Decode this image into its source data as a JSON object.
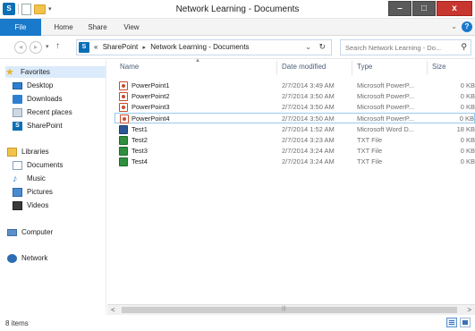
{
  "window": {
    "title": "Network Learning - Documents",
    "minimize_glyph": "–",
    "maximize_glyph": "□",
    "close_glyph": "x",
    "qat_sp_glyph": "S",
    "qat_dropdown_glyph": "▾"
  },
  "ribbon": {
    "tabs": [
      {
        "label": "File"
      },
      {
        "label": "Home"
      },
      {
        "label": "Share"
      },
      {
        "label": "View"
      }
    ],
    "expand_glyph": "⌄",
    "help_glyph": "?",
    "accent_color": "#1979ca"
  },
  "navigation": {
    "back_glyph": "◂",
    "forward_glyph": "▸",
    "history_glyph": "▾",
    "up_glyph": "↑"
  },
  "address": {
    "sp_glyph": "S",
    "overflow": "«",
    "crumbs": [
      "SharePoint",
      "Network Learning - Documents"
    ],
    "separator": "▸",
    "dropdown_glyph": "⌄",
    "refresh_glyph": "↻"
  },
  "search": {
    "placeholder": "Search Network Learning - Do...",
    "icon_glyph": "⚲"
  },
  "nav_pane": {
    "favorites": {
      "label": "Favorites",
      "icon": "star-icon",
      "glyph": "★"
    },
    "favorite_items": [
      {
        "label": "Desktop",
        "icon": "desktop-icon"
      },
      {
        "label": "Downloads",
        "icon": "downloads-icon"
      },
      {
        "label": "Recent places",
        "icon": "recent-places-icon"
      },
      {
        "label": "SharePoint",
        "icon": "sharepoint-icon",
        "glyph": "S"
      }
    ],
    "libraries": {
      "label": "Libraries",
      "icon": "libraries-icon"
    },
    "library_items": [
      {
        "label": "Documents",
        "icon": "documents-icon"
      },
      {
        "label": "Music",
        "icon": "music-icon",
        "glyph": "♪"
      },
      {
        "label": "Pictures",
        "icon": "pictures-icon"
      },
      {
        "label": "Videos",
        "icon": "videos-icon"
      }
    ],
    "computer": {
      "label": "Computer",
      "icon": "computer-icon"
    },
    "network": {
      "label": "Network",
      "icon": "network-icon"
    }
  },
  "file_list": {
    "sort_glyph": "▲",
    "columns": {
      "name": "Name",
      "date": "Date modified",
      "type": "Type",
      "size": "Size"
    },
    "rows": [
      {
        "name": "PowerPoint1",
        "date": "2/7/2014 3:49 AM",
        "type": "Microsoft PowerP...",
        "size": "0 KB",
        "icon": "powerpoint-file-icon",
        "selected": false
      },
      {
        "name": "PowerPoint2",
        "date": "2/7/2014 3:50 AM",
        "type": "Microsoft PowerP...",
        "size": "0 KB",
        "icon": "powerpoint-file-icon",
        "selected": false
      },
      {
        "name": "PowerPoint3",
        "date": "2/7/2014 3:50 AM",
        "type": "Microsoft PowerP...",
        "size": "0 KB",
        "icon": "powerpoint-file-icon",
        "selected": false
      },
      {
        "name": "PowerPoint4",
        "date": "2/7/2014 3:50 AM",
        "type": "Microsoft PowerP...",
        "size": "0 KB",
        "icon": "powerpoint-file-icon",
        "selected": true
      },
      {
        "name": "Test1",
        "date": "2/7/2014 1:52 AM",
        "type": "Microsoft Word D...",
        "size": "18 KB",
        "icon": "word-file-icon",
        "selected": false
      },
      {
        "name": "Test2",
        "date": "2/7/2014 3:23 AM",
        "type": "TXT File",
        "size": "0 KB",
        "icon": "txt-file-icon",
        "selected": false
      },
      {
        "name": "Test3",
        "date": "2/7/2014 3:24 AM",
        "type": "TXT File",
        "size": "0 KB",
        "icon": "txt-file-icon",
        "selected": false
      },
      {
        "name": "Test4",
        "date": "2/7/2014 3:24 AM",
        "type": "TXT File",
        "size": "0 KB",
        "icon": "txt-file-icon",
        "selected": false
      }
    ]
  },
  "scrollbar": {
    "left_glyph": "<",
    "right_glyph": ">",
    "grip_glyph": "|||"
  },
  "status": {
    "item_count": "8 items"
  }
}
